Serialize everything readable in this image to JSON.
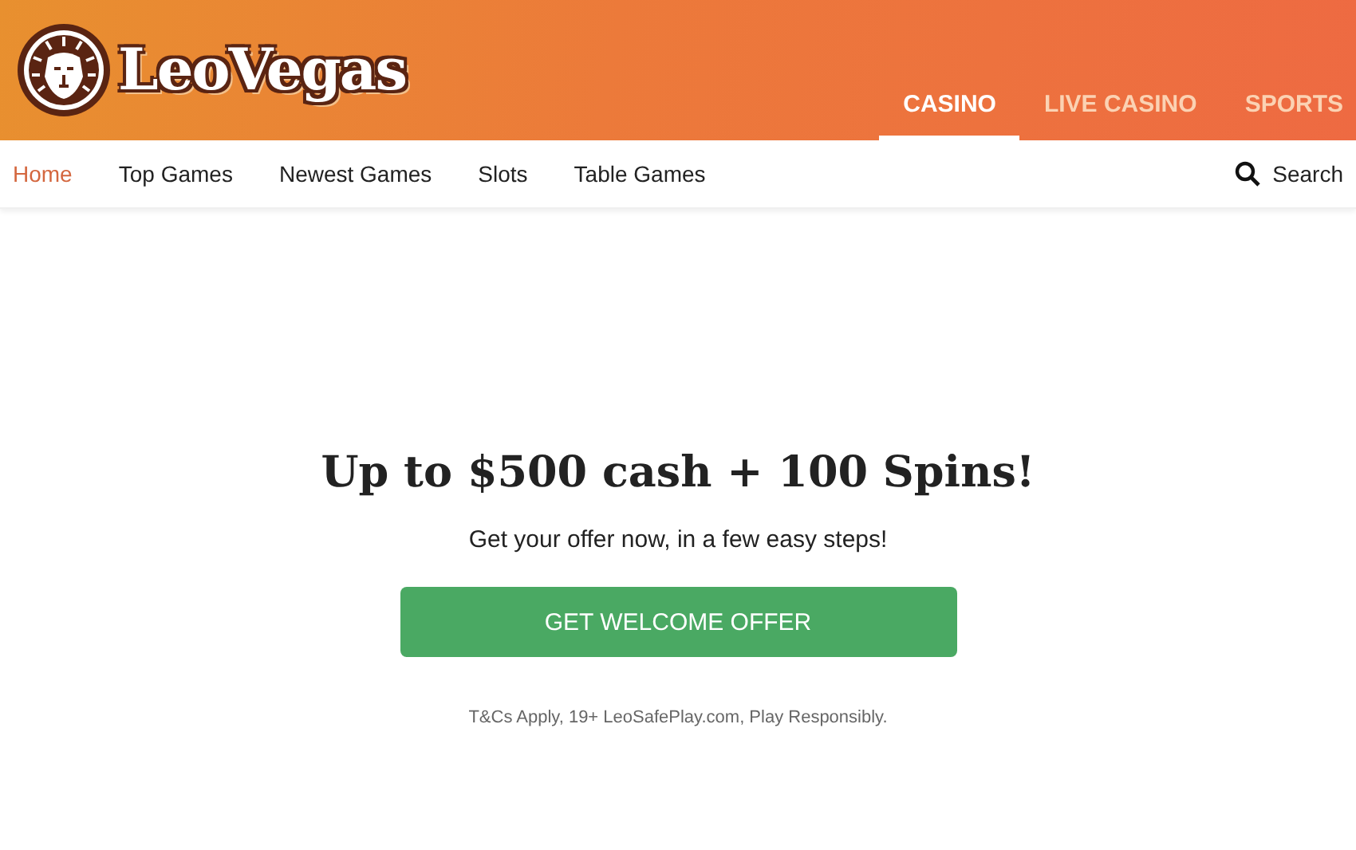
{
  "logo": {
    "text": "LeoVegas"
  },
  "sections": [
    {
      "label": "CASINO",
      "selected": true
    },
    {
      "label": "LIVE CASINO",
      "selected": false
    },
    {
      "label": "SPORTS",
      "selected": false
    }
  ],
  "nav": [
    {
      "label": "Home",
      "selected": true
    },
    {
      "label": "Top Games",
      "selected": false
    },
    {
      "label": "Newest Games",
      "selected": false
    },
    {
      "label": "Slots",
      "selected": false
    },
    {
      "label": "Table Games",
      "selected": false
    }
  ],
  "search": {
    "label": "Search"
  },
  "offer": {
    "headline": "Up to $500 cash + 100 Spins!",
    "subtitle": "Get your offer now, in a few easy steps!",
    "button": "GET WELCOME OFFER",
    "terms": "T&Cs Apply, 19+ LeoSafePlay.com, Play Responsibly."
  }
}
